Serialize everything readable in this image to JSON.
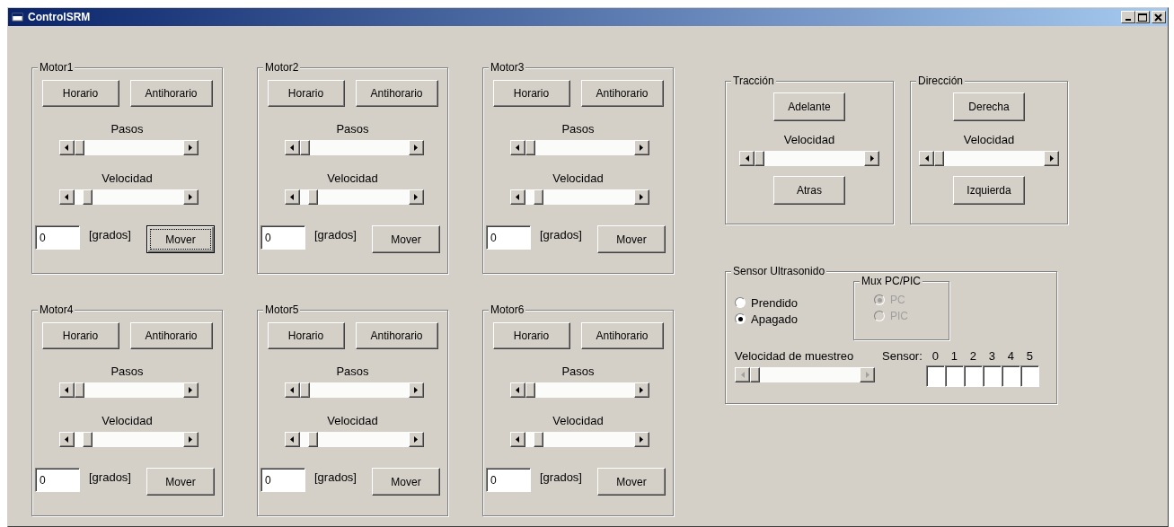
{
  "window": {
    "title": "ControlSRM"
  },
  "motors": [
    {
      "title": "Motor1",
      "buttons": [
        "Horario",
        "Antihorario"
      ],
      "sliders": [
        {
          "label": "Pasos",
          "level": 0
        },
        {
          "label": "Velocidad",
          "level": 0.09
        }
      ],
      "angle": {
        "value": "0",
        "unit": "[grados]"
      },
      "move_button": {
        "label": "Mover",
        "focused": true
      }
    },
    {
      "title": "Motor2",
      "buttons": [
        "Horario",
        "Antihorario"
      ],
      "sliders": [
        {
          "label": "Pasos",
          "level": 0
        },
        {
          "label": "Velocidad",
          "level": 0.09
        }
      ],
      "angle": {
        "value": "0",
        "unit": "[grados]"
      },
      "move_button": {
        "label": "Mover",
        "focused": false
      }
    },
    {
      "title": "Motor3",
      "buttons": [
        "Horario",
        "Antihorario"
      ],
      "sliders": [
        {
          "label": "Pasos",
          "level": 0
        },
        {
          "label": "Velocidad",
          "level": 0.09
        }
      ],
      "angle": {
        "value": "0",
        "unit": "[grados]"
      },
      "move_button": {
        "label": "Mover",
        "focused": false
      }
    },
    {
      "title": "Motor4",
      "buttons": [
        "Horario",
        "Antihorario"
      ],
      "sliders": [
        {
          "label": "Pasos",
          "level": 0
        },
        {
          "label": "Velocidad",
          "level": 0.09
        }
      ],
      "angle": {
        "value": "0",
        "unit": "[grados]"
      },
      "move_button": {
        "label": "Mover",
        "focused": false
      }
    },
    {
      "title": "Motor5",
      "buttons": [
        "Horario",
        "Antihorario"
      ],
      "sliders": [
        {
          "label": "Pasos",
          "level": 0
        },
        {
          "label": "Velocidad",
          "level": 0.09
        }
      ],
      "angle": {
        "value": "0",
        "unit": "[grados]"
      },
      "move_button": {
        "label": "Mover",
        "focused": false
      }
    },
    {
      "title": "Motor6",
      "buttons": [
        "Horario",
        "Antihorario"
      ],
      "sliders": [
        {
          "label": "Pasos",
          "level": 0
        },
        {
          "label": "Velocidad",
          "level": 0.09
        }
      ],
      "angle": {
        "value": "0",
        "unit": "[grados]"
      },
      "move_button": {
        "label": "Mover",
        "focused": false
      }
    }
  ],
  "drive": [
    {
      "title": "Tracción",
      "top_button": "Adelante",
      "slider": {
        "label": "Velocidad",
        "level": 0
      },
      "bottom_button": "Atras"
    },
    {
      "title": "Dirección",
      "top_button": "Derecha",
      "slider": {
        "label": "Velocidad",
        "level": 0
      },
      "bottom_button": "Izquierda"
    }
  ],
  "sensor": {
    "title": "Sensor Ultrasonido",
    "power": [
      {
        "label": "Prendido",
        "selected": false
      },
      {
        "label": "Apagado",
        "selected": true
      }
    ],
    "mux": {
      "title": "Mux PC/PIC",
      "disabled": true,
      "options": [
        {
          "label": "PC",
          "selected": true
        },
        {
          "label": "PIC",
          "selected": false
        }
      ]
    },
    "sampling": {
      "label": "Velocidad de muestreo",
      "level": 0,
      "disabled": true
    },
    "sensor_label": "Sensor:",
    "sensors": [
      {
        "label": "0"
      },
      {
        "label": "1"
      },
      {
        "label": "2"
      },
      {
        "label": "3"
      },
      {
        "label": "4"
      },
      {
        "label": "5"
      }
    ]
  }
}
